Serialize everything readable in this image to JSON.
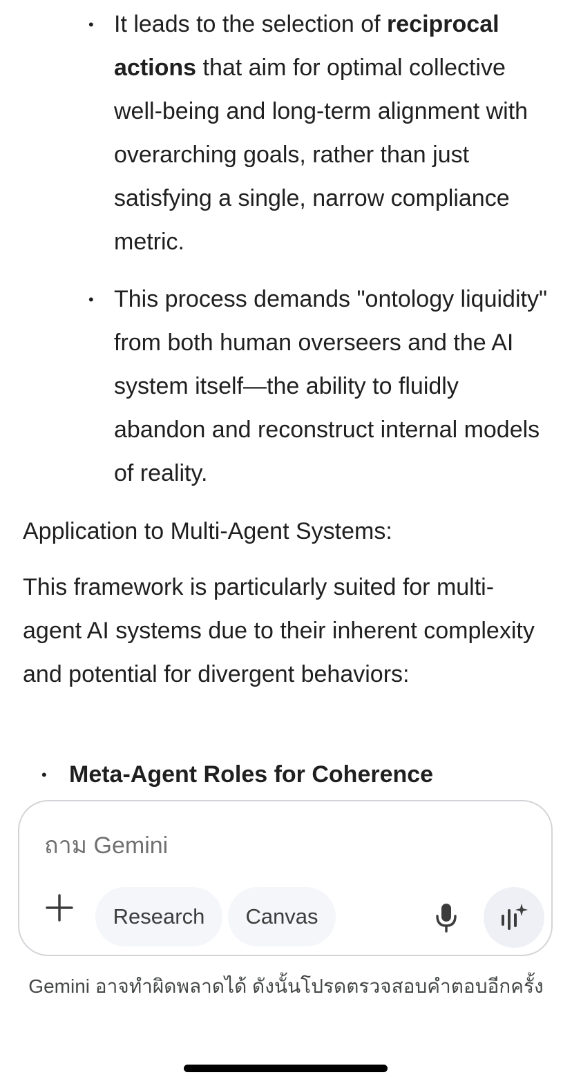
{
  "content": {
    "sub_bullets": [
      {
        "lead": "It leads to the selection of ",
        "bold": "reciprocal actions",
        "rest": " that aim for optimal collective well-being and long-term alignment with overarching goals, rather than just satisfying a single, narrow compliance metric."
      },
      {
        "text": "This process demands \"ontology liquidity\" from both human overseers and the AI system itself—the ability to fluidly abandon and reconstruct internal models of reality."
      }
    ],
    "heading": "Application to Multi-Agent Systems:",
    "paragraph": "This framework is particularly suited for multi-agent AI systems due to their inherent complexity and potential for divergent behaviors:",
    "bullet": "Meta-Agent Roles for Coherence",
    "bullet_marker": "•"
  },
  "composer": {
    "placeholder": "ถาม Gemini",
    "value": "",
    "research_label": "Research",
    "canvas_label": "Canvas"
  },
  "disclaimer": "Gemini อาจทำผิดพลาดได้ ดังนั้นโปรดตรวจสอบคำตอบอีกครั้ง",
  "icons": {
    "plus": "plus-icon",
    "mic": "microphone-icon",
    "live": "gemini-live-icon"
  },
  "colors": {
    "text": "#1f1f1f",
    "chip_bg": "#f4f6fa",
    "border": "#d4d4d8",
    "muted": "#444746"
  }
}
